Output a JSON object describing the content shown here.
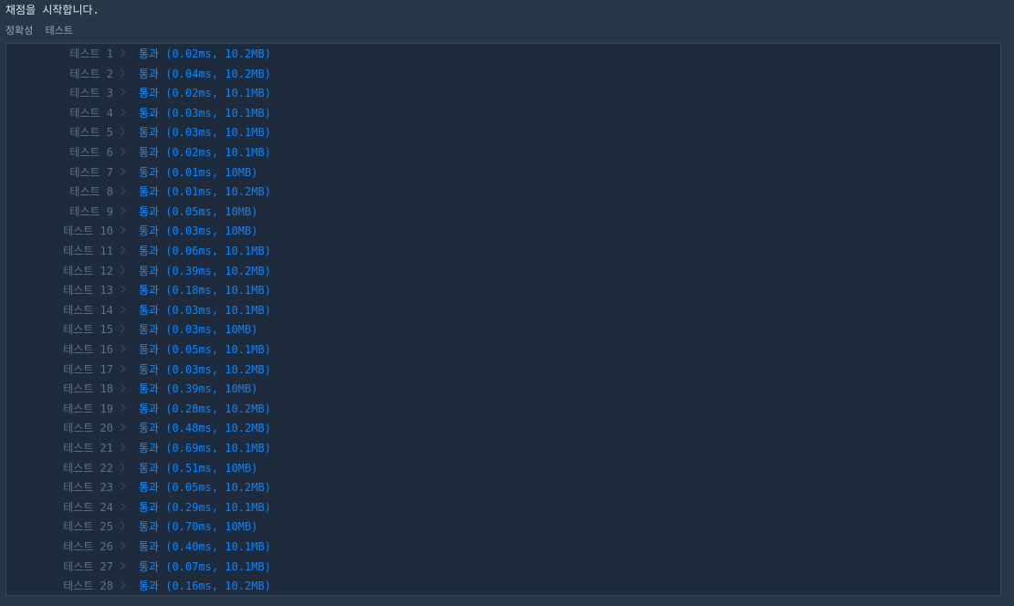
{
  "header": {
    "message": "채점을 시작합니다.",
    "section": "정확성  테스트"
  },
  "tests": [
    {
      "label": "테스트 1",
      "status": "통과",
      "detail": "(0.02ms, 10.2MB)"
    },
    {
      "label": "테스트 2",
      "status": "통과",
      "detail": "(0.04ms, 10.2MB)"
    },
    {
      "label": "테스트 3",
      "status": "통과",
      "detail": "(0.02ms, 10.1MB)"
    },
    {
      "label": "테스트 4",
      "status": "통과",
      "detail": "(0.03ms, 10.1MB)"
    },
    {
      "label": "테스트 5",
      "status": "통과",
      "detail": "(0.03ms, 10.1MB)"
    },
    {
      "label": "테스트 6",
      "status": "통과",
      "detail": "(0.02ms, 10.1MB)"
    },
    {
      "label": "테스트 7",
      "status": "통과",
      "detail": "(0.01ms, 10MB)"
    },
    {
      "label": "테스트 8",
      "status": "통과",
      "detail": "(0.01ms, 10.2MB)"
    },
    {
      "label": "테스트 9",
      "status": "통과",
      "detail": "(0.05ms, 10MB)"
    },
    {
      "label": "테스트 10",
      "status": "통과",
      "detail": "(0.03ms, 10MB)"
    },
    {
      "label": "테스트 11",
      "status": "통과",
      "detail": "(0.06ms, 10.1MB)"
    },
    {
      "label": "테스트 12",
      "status": "통과",
      "detail": "(0.39ms, 10.2MB)"
    },
    {
      "label": "테스트 13",
      "status": "통과",
      "detail": "(0.18ms, 10.1MB)"
    },
    {
      "label": "테스트 14",
      "status": "통과",
      "detail": "(0.03ms, 10.1MB)"
    },
    {
      "label": "테스트 15",
      "status": "통과",
      "detail": "(0.03ms, 10MB)"
    },
    {
      "label": "테스트 16",
      "status": "통과",
      "detail": "(0.05ms, 10.1MB)"
    },
    {
      "label": "테스트 17",
      "status": "통과",
      "detail": "(0.03ms, 10.2MB)"
    },
    {
      "label": "테스트 18",
      "status": "통과",
      "detail": "(0.39ms, 10MB)"
    },
    {
      "label": "테스트 19",
      "status": "통과",
      "detail": "(0.28ms, 10.2MB)"
    },
    {
      "label": "테스트 20",
      "status": "통과",
      "detail": "(0.48ms, 10.2MB)"
    },
    {
      "label": "테스트 21",
      "status": "통과",
      "detail": "(0.69ms, 10.1MB)"
    },
    {
      "label": "테스트 22",
      "status": "통과",
      "detail": "(0.51ms, 10MB)"
    },
    {
      "label": "테스트 23",
      "status": "통과",
      "detail": "(0.05ms, 10.2MB)"
    },
    {
      "label": "테스트 24",
      "status": "통과",
      "detail": "(0.29ms, 10.1MB)"
    },
    {
      "label": "테스트 25",
      "status": "통과",
      "detail": "(0.70ms, 10MB)"
    },
    {
      "label": "테스트 26",
      "status": "통과",
      "detail": "(0.40ms, 10.1MB)"
    },
    {
      "label": "테스트 27",
      "status": "통과",
      "detail": "(0.07ms, 10.1MB)"
    },
    {
      "label": "테스트 28",
      "status": "통과",
      "detail": "(0.16ms, 10.2MB)"
    }
  ],
  "colors": {
    "background": "#263747",
    "panel": "#1e2b3c",
    "pass": "#0a84ff",
    "label": "#5e7186"
  },
  "icons": {
    "row_separator": "chevron-right-icon"
  }
}
